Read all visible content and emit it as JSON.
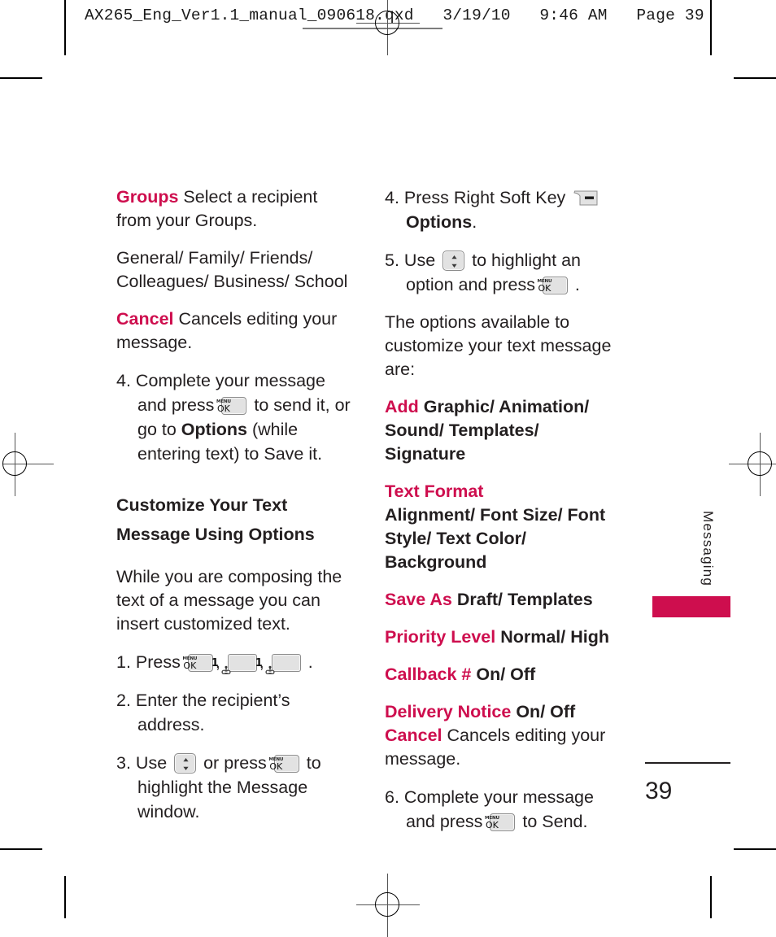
{
  "prepress": {
    "filename_line": "AX265_Eng_Ver1.1_manual_090618.qxd   3/19/10   9:46 AM   Page 39"
  },
  "page": {
    "folio": "39",
    "side_tab_label": "Messaging",
    "accent_color": "#ce0e4e",
    "text_color": "#231f20"
  },
  "left_column": {
    "groups_term": "Groups",
    "groups_desc": " Select a recipient from your Groups.",
    "groups_list": "General/ Family/ Friends/ Colleagues/ Business/ School",
    "cancel_term": "Cancel",
    "cancel_desc": "  Cancels editing your message.",
    "step4_num": "4.",
    "step4_part1": " Complete your message and press ",
    "step4_part2": " to send it, or go to ",
    "step4_options": "Options",
    "step4_part3": " (while entering text) to Save it.",
    "heading": "Customize Your Text Message Using Options",
    "intro": "While you are composing the text of a message you can insert customized text.",
    "step1_num": "1.",
    "step1_press": " Press ",
    "step1_comma1": ", ",
    "step1_comma2": ", ",
    "step1_period": " .",
    "step2": "2. Enter the recipient’s address.",
    "step3_num": "3.",
    "step3_use": " Use ",
    "step3_orpress": " or press ",
    "step3_tail": " to highlight the Message window."
  },
  "right_column": {
    "step4_num": "4.",
    "step4_text": " Press Right Soft Key ",
    "step4_options": "Options",
    "step4_period": ".",
    "step5_num": "5.",
    "step5_use": " Use ",
    "step5_mid": " to highlight an option and press ",
    "step5_period": " .",
    "options_intro": "The options available to customize your text message are:",
    "options": [
      {
        "term": "Add",
        "values": " Graphic/ Animation/ Sound/ Templates/ Signature",
        "break_after_term": false
      },
      {
        "term": "Text Format",
        "values": "Alignment/ Font Size/ Font Style/ Text Color/ Background",
        "break_after_term": true
      },
      {
        "term": "Save As",
        "values": " Draft/ Templates",
        "break_after_term": false
      },
      {
        "term": "Priority Level",
        "values": " Normal/ High",
        "break_after_term": false
      },
      {
        "term": "Callback #",
        "values": " On/ Off",
        "break_after_term": false
      },
      {
        "term": "Delivery Notice",
        "values": " On/   Off",
        "break_after_term": false
      }
    ],
    "cancel_term": "Cancel",
    "cancel_desc": " Cancels editing your message.",
    "step6_num": "6.",
    "step6_part1": " Complete your message and press ",
    "step6_part2": " to Send."
  },
  "icons": {
    "menu_ok": {
      "name": "menu-ok-key-icon",
      "top_label": "MENU",
      "bottom_label": "OK"
    },
    "num_one": {
      "name": "number-one-key-icon",
      "digit": "1"
    },
    "nav_updown": {
      "name": "navigation-up-down-key-icon"
    },
    "right_soft": {
      "name": "right-soft-key-icon"
    }
  }
}
